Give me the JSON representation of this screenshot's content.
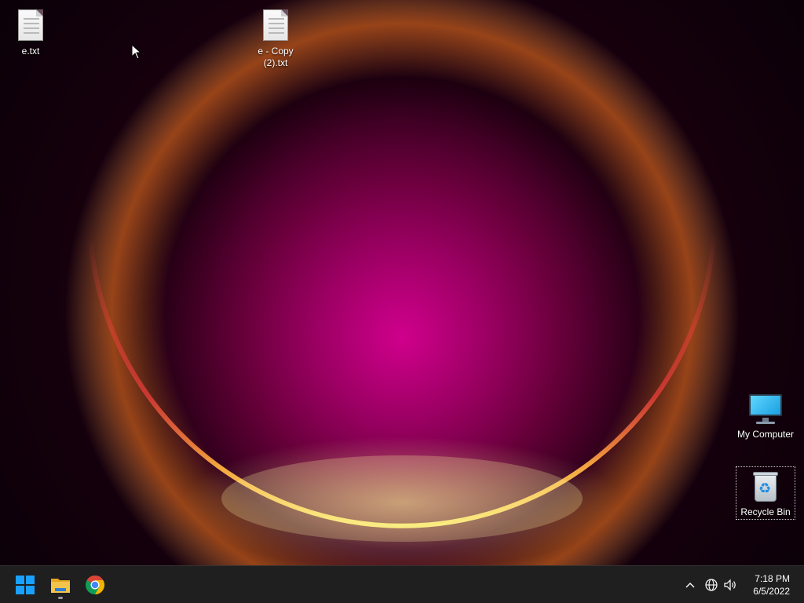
{
  "desktop": {
    "icons": [
      {
        "label": "e.txt",
        "kind": "text-file-icon"
      },
      {
        "label": "e - Copy (2).txt",
        "kind": "text-file-icon"
      },
      {
        "label": "My Computer",
        "kind": "computer-icon"
      },
      {
        "label": "Recycle Bin",
        "kind": "recycle-bin-icon",
        "selected": true
      }
    ]
  },
  "taskbar": {
    "pinned": [
      {
        "name": "Start",
        "icon": "windows-start-icon"
      },
      {
        "name": "File Explorer",
        "icon": "file-explorer-icon",
        "running": true
      },
      {
        "name": "Google Chrome",
        "icon": "chrome-icon"
      }
    ],
    "tray": {
      "overflow_icon": "chevron-up-icon",
      "network_icon": "globe-icon",
      "volume_icon": "speaker-icon"
    },
    "clock": {
      "time": "7:18 PM",
      "date": "6/5/2022"
    }
  },
  "colors": {
    "taskbar_bg": "#1f1f1f",
    "accent_blue": "#1aa0ff",
    "chrome_red": "#db4437",
    "chrome_yellow": "#f4b400",
    "chrome_green": "#0f9d58",
    "folder_yellow": "#f3c44c"
  }
}
